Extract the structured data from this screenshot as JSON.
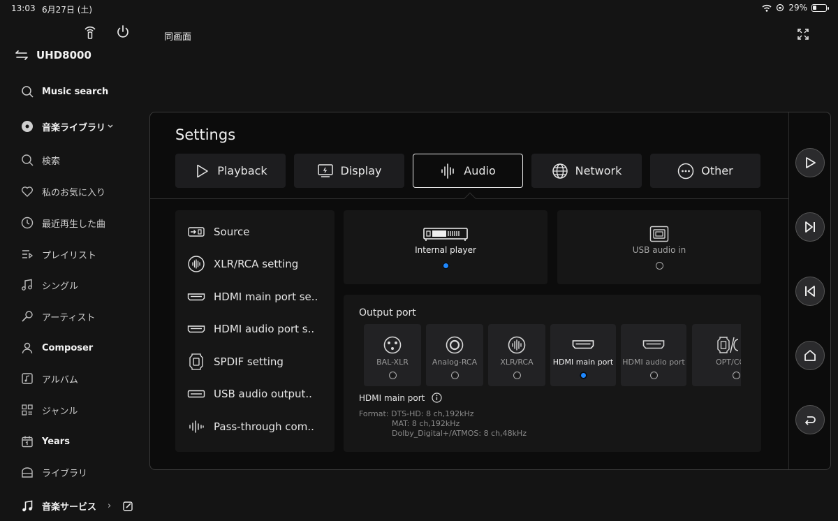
{
  "status_bar": {
    "time": "13:03",
    "date": "6月27日 (土)",
    "battery_percent": "29%",
    "battery_level": 0.29
  },
  "header": {
    "device_name": "UHD8000",
    "page_title": "同画面"
  },
  "sidebar": {
    "items": [
      {
        "label": "Music search",
        "icon": "search-icon",
        "bold": true
      },
      {
        "label": "音楽ライブラリ",
        "icon": "disc-icon",
        "bold": true
      },
      {
        "label": "検索",
        "icon": "search-icon"
      },
      {
        "label": "私のお気に入り",
        "icon": "heart-icon"
      },
      {
        "label": "最近再生した曲",
        "icon": "clock-icon"
      },
      {
        "label": "プレイリスト",
        "icon": "playlist-icon"
      },
      {
        "label": "シングル",
        "icon": "music-note-icon"
      },
      {
        "label": "アーティスト",
        "icon": "microphone-icon"
      },
      {
        "label": "Composer",
        "icon": "person-icon"
      },
      {
        "label": "アルバム",
        "icon": "album-icon"
      },
      {
        "label": "ジャンル",
        "icon": "grid-icon"
      },
      {
        "label": "Years",
        "icon": "calendar-icon"
      },
      {
        "label": "ライブラリ",
        "icon": "library-icon"
      }
    ],
    "bottom": {
      "label": "音楽サービス",
      "chevron": "›"
    }
  },
  "settings": {
    "title": "Settings",
    "tabs": [
      {
        "label": "Playback",
        "icon": "play-outline-icon"
      },
      {
        "label": "Display",
        "icon": "display-icon"
      },
      {
        "label": "Audio",
        "icon": "waveform-icon",
        "active": true
      },
      {
        "label": "Network",
        "icon": "globe-icon"
      },
      {
        "label": "Other",
        "icon": "more-icon"
      }
    ],
    "menu": [
      "Source",
      "XLR/RCA setting",
      "HDMI main port se..",
      "HDMI audio port s..",
      "SPDIF setting",
      "USB audio output..",
      "Pass-through com.."
    ],
    "sources": [
      {
        "label": "Internal player",
        "selected": true
      },
      {
        "label": "USB audio in",
        "selected": false
      }
    ],
    "output": {
      "title": "Output port",
      "ports": [
        {
          "label": "BAL-XLR",
          "selected": false
        },
        {
          "label": "Analog-RCA",
          "selected": false
        },
        {
          "label": "XLR/RCA",
          "selected": false
        },
        {
          "label": "HDMI main port",
          "selected": true
        },
        {
          "label": "HDMI audio port",
          "selected": false
        },
        {
          "label": "OPT/COAX",
          "selected": false
        }
      ],
      "detail_title": "HDMI main port",
      "format_label": "Format:",
      "formats": [
        "DTS-HD: 8 ch,192kHz",
        "MAT: 8 ch,192kHz",
        "Dolby_Digital+/ATMOS: 8 ch,48kHz"
      ]
    }
  },
  "colors": {
    "accent": "#1e88ff",
    "panel": "#0c0c0c",
    "card": "#161616"
  }
}
